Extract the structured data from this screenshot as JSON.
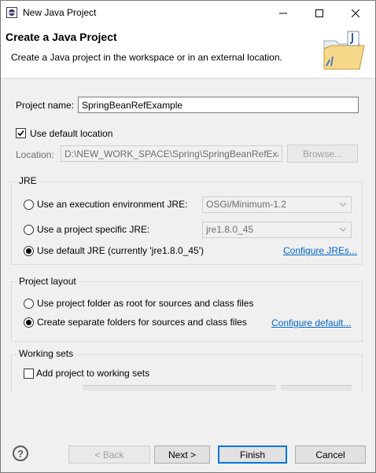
{
  "window": {
    "title": "New Java Project"
  },
  "header": {
    "title": "Create a Java Project",
    "description": "Create a Java project in the workspace or in an external location."
  },
  "project_name": {
    "label": "Project name:",
    "value": "SpringBeanRefExample"
  },
  "default_location": {
    "checkbox_label": "Use default location",
    "checked": true,
    "location_label": "Location:",
    "location_value": "D:\\NEW_WORK_SPACE\\Spring\\SpringBeanRefExamp",
    "browse_label": "Browse..."
  },
  "jre": {
    "group_title": "JRE",
    "option_env_label": "Use an execution environment JRE:",
    "option_env_value": "OSGi/Minimum-1.2",
    "option_specific_label": "Use a project specific JRE:",
    "option_specific_value": "jre1.8.0_45",
    "option_default_label": "Use default JRE (currently 'jre1.8.0_45')",
    "selected": "default",
    "configure_link": "Configure JREs..."
  },
  "project_layout": {
    "group_title": "Project layout",
    "option_root_label": "Use project folder as root for sources and class files",
    "option_separate_label": "Create separate folders for sources and class files",
    "selected": "separate",
    "configure_link": "Configure default..."
  },
  "working_sets": {
    "group_title": "Working sets",
    "checkbox_label": "Add project to working sets",
    "checked": false
  },
  "footer": {
    "back_label": "< Back",
    "next_label": "Next >",
    "finish_label": "Finish",
    "cancel_label": "Cancel"
  },
  "icons": {
    "app": "eclipse-icon",
    "header": "java-project-folder-icon",
    "help": "help-icon"
  },
  "colors": {
    "link": "#0066cc",
    "default_button_border": "#0078d7"
  }
}
